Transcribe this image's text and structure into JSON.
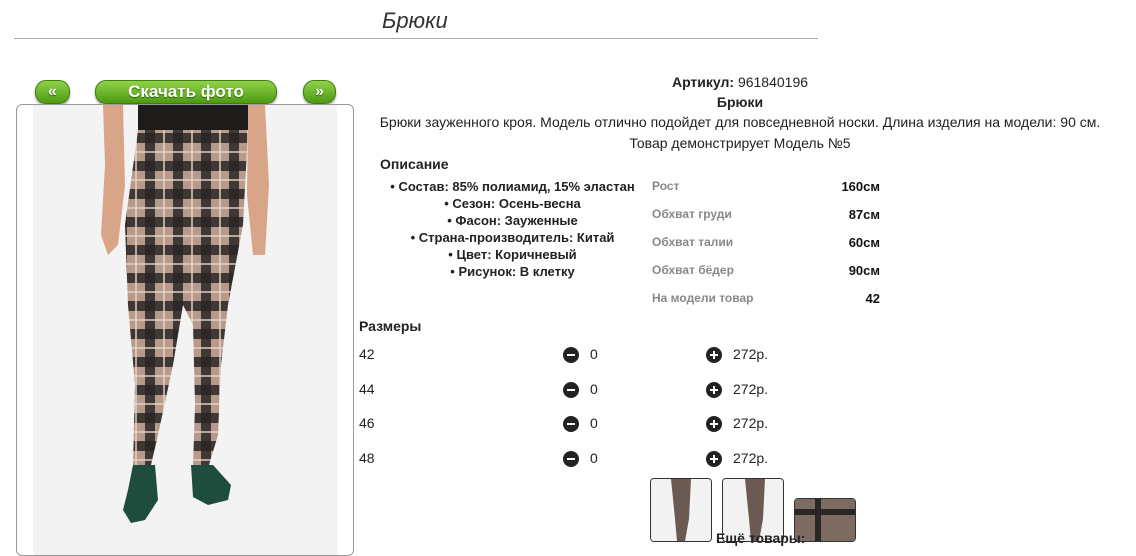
{
  "page": {
    "title": "Брюки"
  },
  "nav": {
    "prev": "«",
    "download": "Скачать фото",
    "next": "»"
  },
  "product": {
    "article_label": "Артикул:",
    "article": "961840196",
    "name": "Брюки",
    "description": "Брюки зауженного кроя. Модель отлично подойдет для повседневной носки. Длина изделия на модели: 90 см.",
    "model_note": "Товар демонстрирует Модель №5"
  },
  "description": {
    "heading": "Описание",
    "items": [
      "Состав: 85% полиамид, 15% эластан",
      "Сезон: Осень-весна",
      "Фасон: Зауженные",
      "Страна-производитель: Китай",
      "Цвет: Коричневый",
      "Рисунок: В клетку"
    ]
  },
  "measurements": [
    {
      "label": "Рост",
      "value": "160см"
    },
    {
      "label": "Обхват груди",
      "value": "87см"
    },
    {
      "label": "Обхват талии",
      "value": "60см"
    },
    {
      "label": "Обхват бёдер",
      "value": "90см"
    },
    {
      "label": "На модели товар",
      "value": "42"
    }
  ],
  "sizes": {
    "heading": "Размеры",
    "rows": [
      {
        "size": "42",
        "qty": "0",
        "price": "272р."
      },
      {
        "size": "44",
        "qty": "0",
        "price": "272р."
      },
      {
        "size": "46",
        "qty": "0",
        "price": "272р."
      },
      {
        "size": "48",
        "qty": "0",
        "price": "272р."
      }
    ]
  },
  "more_label": "Ещё товары:",
  "icons": [
    "minus-circle-icon",
    "plus-circle-icon"
  ]
}
